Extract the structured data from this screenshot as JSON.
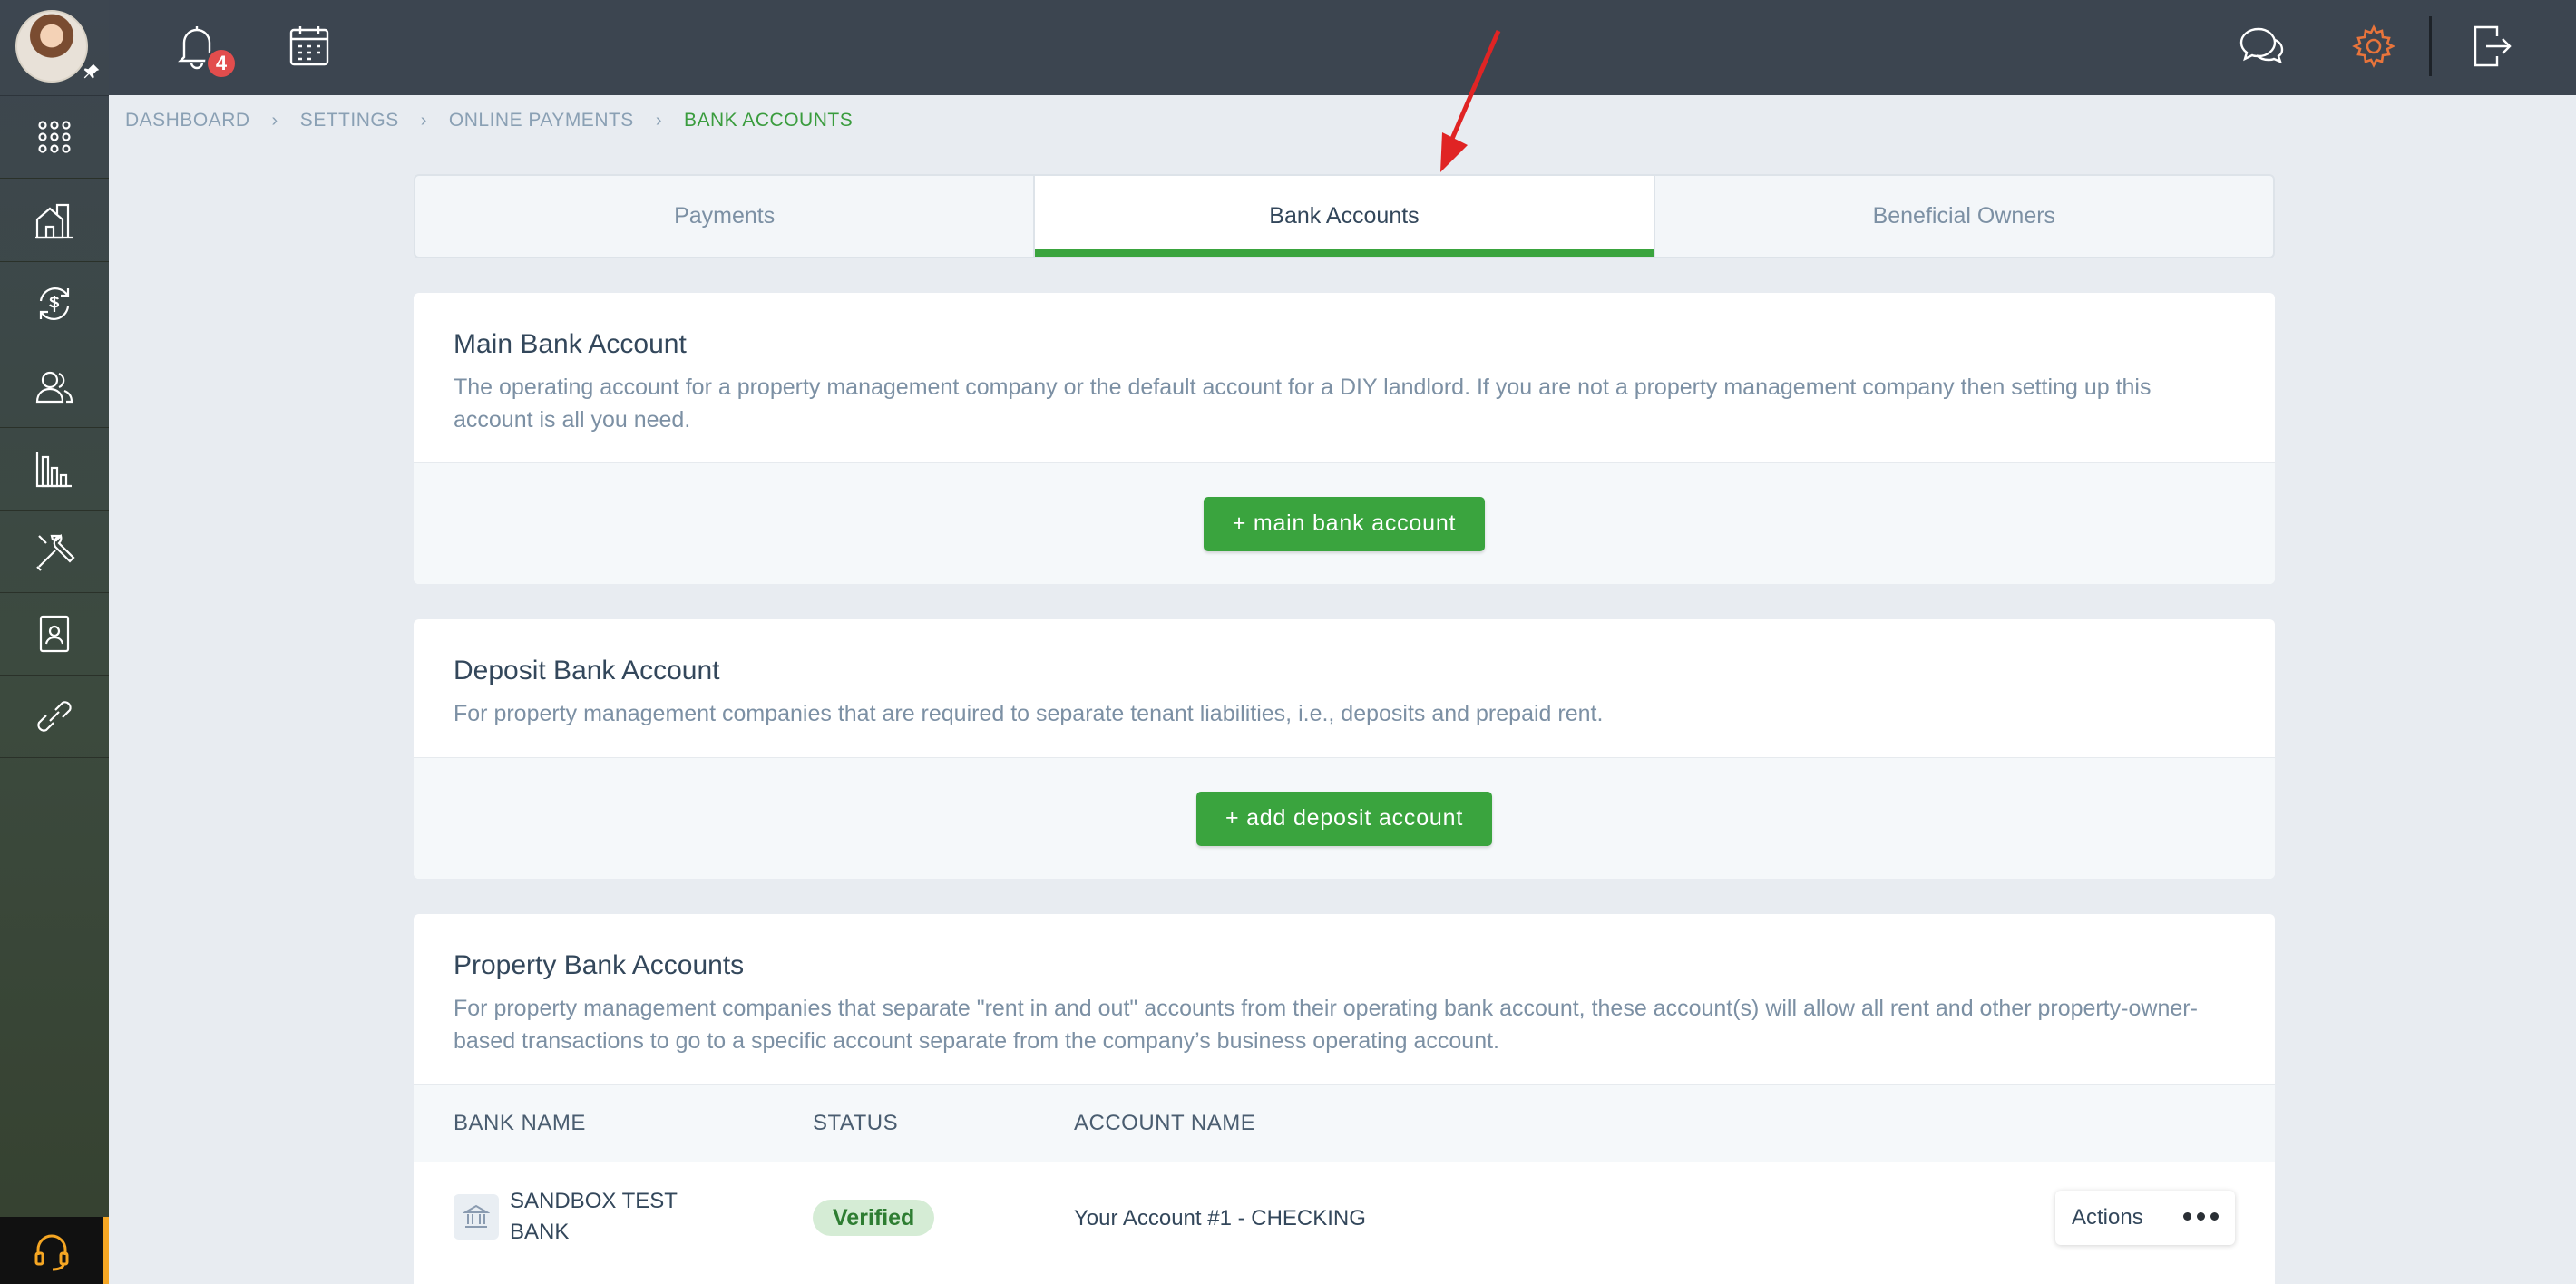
{
  "topbar": {
    "notification_count": "4"
  },
  "breadcrumb": [
    "DASHBOARD",
    "SETTINGS",
    "ONLINE PAYMENTS",
    "BANK ACCOUNTS"
  ],
  "tabs": [
    {
      "label": "Payments"
    },
    {
      "label": "Bank Accounts"
    },
    {
      "label": "Beneficial Owners"
    }
  ],
  "main_account": {
    "title": "Main Bank Account",
    "description": "The operating account for a property management company or the default account for a DIY landlord. If you are not a property management company then setting up this account is all you need.",
    "button": "+ main bank account"
  },
  "deposit_account": {
    "title": "Deposit Bank Account",
    "description": "For property management companies that are required to separate tenant liabilities, i.e., deposits and prepaid rent.",
    "button": "+ add deposit account"
  },
  "property_accounts": {
    "title": "Property Bank Accounts",
    "description": "For property management companies that separate \"rent in and out\" accounts from their operating bank account, these account(s) will allow all rent and other property-owner-based transactions to go to a specific account separate from the company’s business operating account.",
    "columns": [
      "BANK NAME",
      "STATUS",
      "ACCOUNT NAME"
    ],
    "rows": [
      {
        "bank_name_line1": "SANDBOX TEST",
        "bank_name_line2": "BANK",
        "status": "Verified",
        "account_name": "Your Account #1 - CHECKING",
        "actions": "Actions"
      }
    ]
  },
  "colors": {
    "accent": "#3aa43e",
    "sidebar": "#3d4650",
    "topbar": "#3c4550",
    "settings_icon": "#e8743b",
    "badge": "#e24d4d"
  }
}
